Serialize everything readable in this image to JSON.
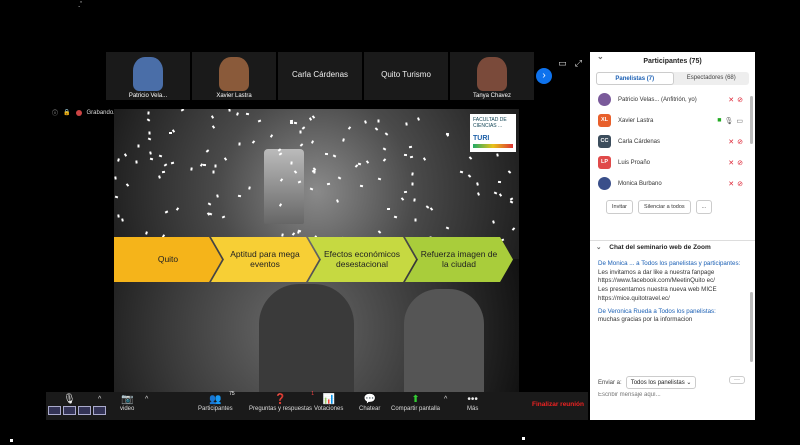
{
  "video_tiles": [
    {
      "name": "Patricio Vela...",
      "type": "video",
      "color": "#4a6ea8"
    },
    {
      "name": "Xavier Lastra",
      "type": "video",
      "color": "#8a5a3a"
    },
    {
      "name": "Carla Cárdenas",
      "type": "text"
    },
    {
      "name": "Quito Turismo",
      "type": "text"
    },
    {
      "name": "Tanya Chavez",
      "type": "video",
      "color": "#7a4a3a"
    }
  ],
  "recording": {
    "label": "Grabando..."
  },
  "slide": {
    "logo_title": "FACULTAD DE CIENCIAS ...",
    "logo_turi": "TURI",
    "chevrons": [
      {
        "label": "Quito",
        "color": "#f5b41a"
      },
      {
        "label": "Aptitud para mega eventos",
        "color": "#f7cf35"
      },
      {
        "label": "Efectos económicos desestacional",
        "color": "#c6d941"
      },
      {
        "label": "Refuerza imagen de la ciudad",
        "color": "#a9cd3b"
      }
    ]
  },
  "toolbar": {
    "video_label": "video",
    "participants_label": "Participantes",
    "participants_count": "75",
    "qa_label": "Preguntas y respuestas",
    "qa_badge": "1",
    "polls_label": "Votaciones",
    "chat_label": "Chatear",
    "share_label": "Compartir pantalla",
    "more_label": "Más",
    "end_label": "Finalizar reunión"
  },
  "participants": {
    "title": "Participantes (75)",
    "tab_panelists": "Panelistas (7)",
    "tab_attendees": "Espectadores (68)",
    "list": [
      {
        "name": "Patricio Velas... (Anfitrión, yo)",
        "initials": "",
        "color": "#7a5a9a"
      },
      {
        "name": "Xavier Lastra",
        "initials": "XL",
        "color": "#e8602c"
      },
      {
        "name": "Carla Cárdenas",
        "initials": "CC",
        "color": "#3c4d5c"
      },
      {
        "name": "Luis Proaño",
        "initials": "LP",
        "color": "#e04a4a"
      },
      {
        "name": "Monica Burbano",
        "initials": "",
        "color": "#3a4f8a"
      }
    ],
    "invite_label": "Invitar",
    "mute_all_label": "Silenciar a todos",
    "more_label": "..."
  },
  "chat": {
    "title": "Chat del seminario web de Zoom",
    "messages": [
      {
        "from": "De Monica ... a Todos los panelistas y participantes:",
        "lines": [
          "Les invitamos a dar like a nuestra fanpage",
          "https://www.facebook.com/MeetinQuito ec/",
          "Les presentamos nuestra nueva web MICE https://mice.quitotravel.ec/"
        ]
      },
      {
        "from": "De Veronica Rueda a Todos los panelistas:",
        "lines": [
          "muchas  gracias  por la informacion"
        ]
      }
    ],
    "send_to_label": "Enviar a:",
    "send_to_value": "Todos los panelistas",
    "placeholder": "Escribir mensaje aquí..."
  }
}
